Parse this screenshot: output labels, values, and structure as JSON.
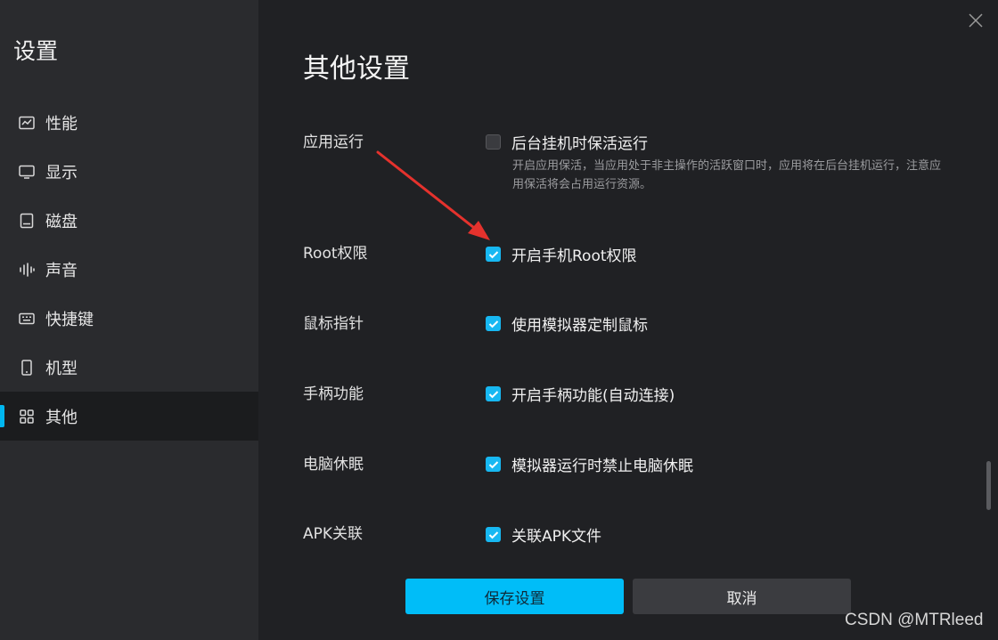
{
  "sidebar": {
    "title": "设置",
    "items": [
      {
        "label": "性能",
        "icon": "chart-icon"
      },
      {
        "label": "显示",
        "icon": "monitor-icon"
      },
      {
        "label": "磁盘",
        "icon": "disk-icon"
      },
      {
        "label": "声音",
        "icon": "sound-wave-icon"
      },
      {
        "label": "快捷键",
        "icon": "keyboard-icon"
      },
      {
        "label": "机型",
        "icon": "phone-icon"
      },
      {
        "label": "其他",
        "icon": "grid-icon",
        "active": true
      }
    ]
  },
  "main": {
    "title": "其他设置",
    "sections": [
      {
        "label": "应用运行",
        "option": "后台挂机时保活运行",
        "checked": false,
        "description": "开启应用保活，当应用处于非主操作的活跃窗口时，应用将在后台挂机运行，注意应用保活将会占用运行资源。"
      },
      {
        "label": "Root权限",
        "option": "开启手机Root权限",
        "checked": true
      },
      {
        "label": "鼠标指针",
        "option": "使用模拟器定制鼠标",
        "checked": true
      },
      {
        "label": "手柄功能",
        "option": "开启手柄功能(自动连接)",
        "checked": true
      },
      {
        "label": "电脑休眠",
        "option": "模拟器运行时禁止电脑休眠",
        "checked": true
      },
      {
        "label": "APK关联",
        "option": "关联APK文件",
        "checked": true
      }
    ]
  },
  "buttons": {
    "save": "保存设置",
    "cancel": "取消"
  },
  "watermark": "CSDN @MTRleed",
  "colors": {
    "accent": "#00bdf8",
    "checkbox": "#17b8f2",
    "arrow": "#e5322d"
  }
}
